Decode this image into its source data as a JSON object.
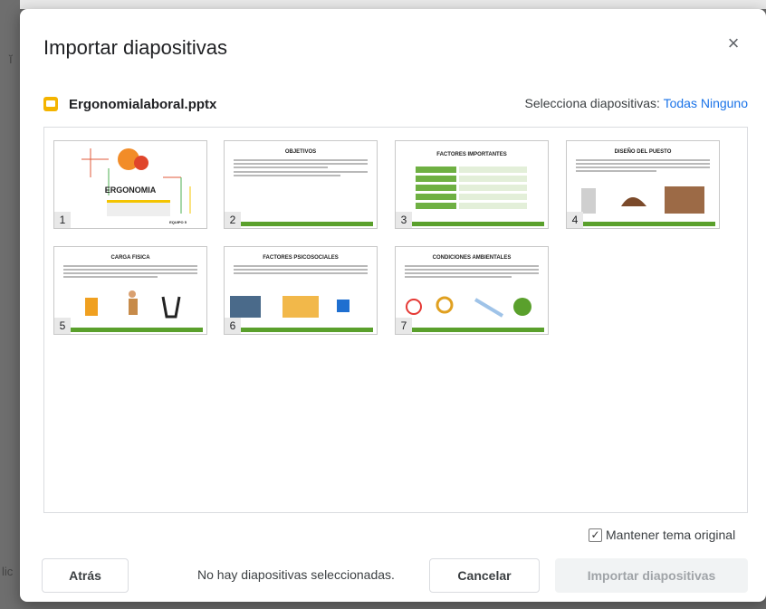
{
  "background": {
    "left_fragment_top": "ĭ",
    "left_fragment_bottom": "lic"
  },
  "dialog": {
    "title": "Importar diapositivas",
    "close_symbol": "×"
  },
  "file": {
    "name": "Ergonomialaboral.pptx",
    "icon": "slides-file-icon",
    "icon_color": "#f4b400"
  },
  "selection": {
    "label": "Selecciona diapositivas:",
    "all": "Todas",
    "none": "Ninguno"
  },
  "slides": [
    {
      "number": "1",
      "title": "ERGONOMIA"
    },
    {
      "number": "2",
      "title": "OBJETIVOS"
    },
    {
      "number": "3",
      "title": "FACTORES IMPORTANTES"
    },
    {
      "number": "4",
      "title": "DISEÑO DEL PUESTO"
    },
    {
      "number": "5",
      "title": "CARGA FISICA"
    },
    {
      "number": "6",
      "title": "FACTORES PSICOSOCIALES"
    },
    {
      "number": "7",
      "title": "CONDICIONES AMBIENTALES"
    }
  ],
  "slide1_extra": {
    "footer": "EQUIPO 5"
  },
  "keep_theme": {
    "label": "Mantener tema original",
    "checked": true
  },
  "footer": {
    "back_label": "Atrás",
    "status": "No hay diapositivas seleccionadas.",
    "cancel_label": "Cancelar",
    "import_label": "Importar diapositivas"
  },
  "colors": {
    "accent": "#1a73e8",
    "slide_bar": "#5aa02c"
  }
}
